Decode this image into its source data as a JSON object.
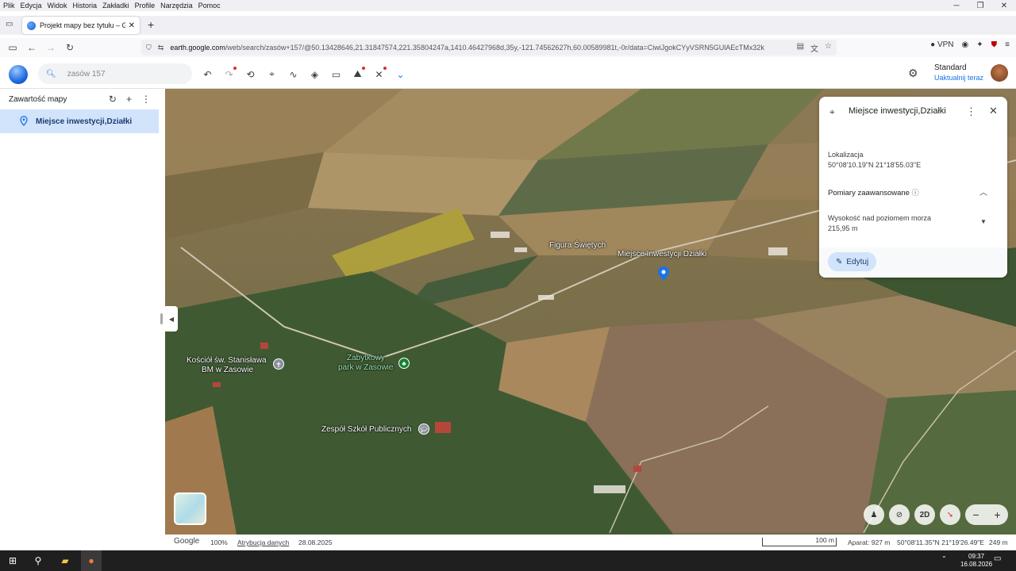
{
  "menu": {
    "items": [
      "Plik",
      "Edycja",
      "Widok",
      "Historia",
      "Zakładki",
      "Profile",
      "Narzędzia",
      "Pomoc"
    ]
  },
  "window": {
    "minimize": "─",
    "restore": "❐",
    "close": "✕"
  },
  "tab": {
    "title": "Projekt mapy bez tytułu – Google Earth",
    "close": "✕",
    "new_tab": "+"
  },
  "nav": {
    "url_domain": "earth.google.com",
    "url_rest": "/web/search/zasów+157/@50.13428646,21.31847574,221.35804247a,1410.46427968d,35y,-121.74562627h,60.00589981t,-0r/data=CiwiJgokCYyVSRN5GUlAEcTMx32k",
    "vpn_label": "VPN"
  },
  "app": {
    "search_placeholder": "zasów 157",
    "account_tier": "Standard",
    "account_update": "Uaktualnij teraz"
  },
  "sidebar": {
    "title": "Zawartość mapy",
    "items": [
      {
        "label": "Miejsce inwestycji,Działki"
      }
    ]
  },
  "map": {
    "labels": {
      "figura": "Figura Świętych",
      "miejsce": "Miejsce Inwestycji Działki",
      "kosciol_line1": "Kościół św. Stanisława",
      "kosciol_line2": "BM w Zasowie",
      "park_line1": "Zabytkowy",
      "park_line2": "park w Zasowie",
      "szkola": "Zespół Szkół Publicznych"
    }
  },
  "info_panel": {
    "title": "Miejsce inwestycji,Działki",
    "location_label": "Lokalizacja",
    "location_value": "50°08'10.19\"N 21°18'55.03\"E",
    "advanced_label": "Pomiary zaawansowane",
    "elevation_label": "Wysokość nad poziomem morza",
    "elevation_value": "215,95 m",
    "edit_label": "Edytuj"
  },
  "map_controls": {
    "mode_2d": "2D"
  },
  "status": {
    "brand": "Google",
    "zoom": "100%",
    "attribution": "Atrybucja danych",
    "date": "28.08.2025",
    "scale": "100 m",
    "camera": "Aparat: 927 m",
    "coords": "50°08'11.35\"N 21°19'26.49\"E",
    "elevation": "249 m"
  },
  "taskbar": {
    "time": "09:37",
    "date": "16.08.2026"
  }
}
